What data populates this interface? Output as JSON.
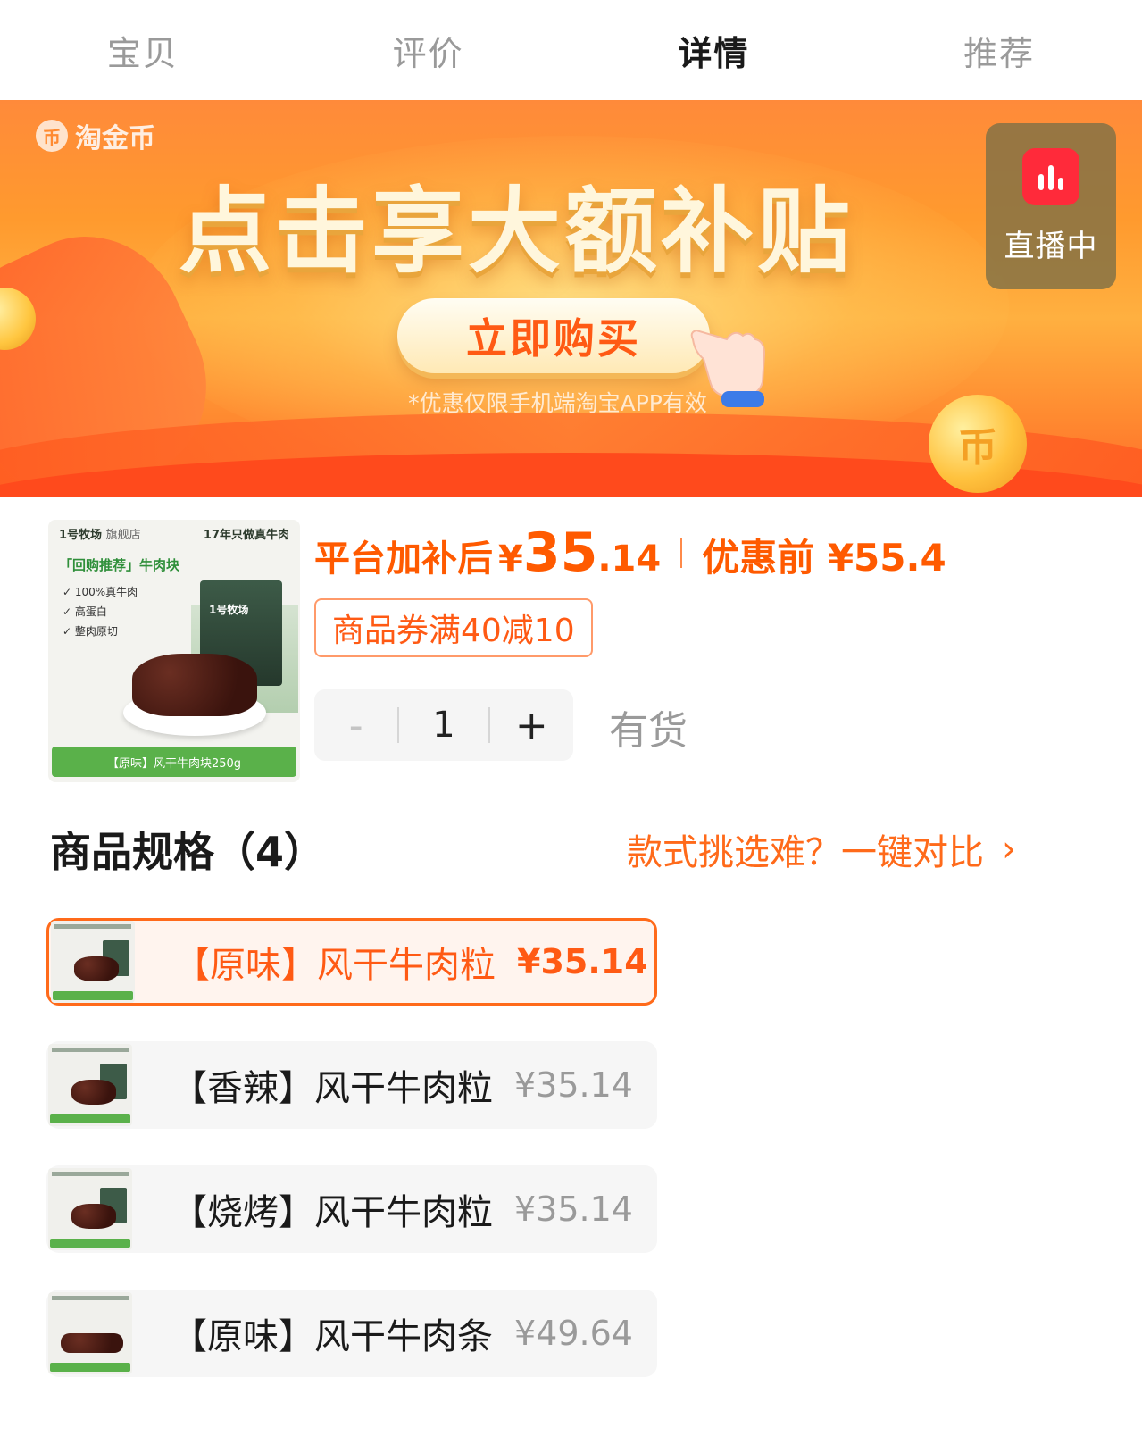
{
  "tabs": [
    {
      "label": "宝贝",
      "active": false
    },
    {
      "label": "评价",
      "active": false
    },
    {
      "label": "详情",
      "active": true
    },
    {
      "label": "推荐",
      "active": false
    }
  ],
  "banner": {
    "brand": "淘金币",
    "headline": "点击享大额补贴",
    "buy_button": "立即购买",
    "disclaimer": "*优惠仅限手机端淘宝APP有效",
    "live_label": "直播中"
  },
  "product": {
    "thumb": {
      "brand": "1号牧场",
      "store_type": "旗舰店",
      "slogan": "17年只做真牛肉",
      "tag": "「回购推荐」牛肉块",
      "features": [
        "100%真牛肉",
        "高蛋白",
        "整肉原切"
      ],
      "pack_label": "1号牧场",
      "footer": "【原味】风干牛肉块250g"
    },
    "price_label": "平台加补后",
    "currency": "¥",
    "price_int": "35",
    "price_dec": ".14",
    "before_label": "优惠前 ¥55.4",
    "coupon": "商品券满40减10",
    "quantity": "1",
    "minus": "-",
    "plus": "+",
    "stock": "有货"
  },
  "specs": {
    "title": "商品规格（4）",
    "compare_label": "款式挑选难？一键对比",
    "options": [
      {
        "name": "【原味】风干牛肉粒",
        "price": "¥35.14",
        "selected": true
      },
      {
        "name": "【香辣】风干牛肉粒",
        "price": "¥35.14",
        "selected": false
      },
      {
        "name": "【烧烤】风干牛肉粒",
        "price": "¥35.14",
        "selected": false
      },
      {
        "name": "【原味】风干牛肉条",
        "price": "¥49.64",
        "selected": false
      }
    ]
  },
  "colors": {
    "accent": "#ff5a14",
    "selected_border": "#ff6a1a",
    "live_badge": "#ff2a3a",
    "thumb_green": "#5ab14a"
  }
}
